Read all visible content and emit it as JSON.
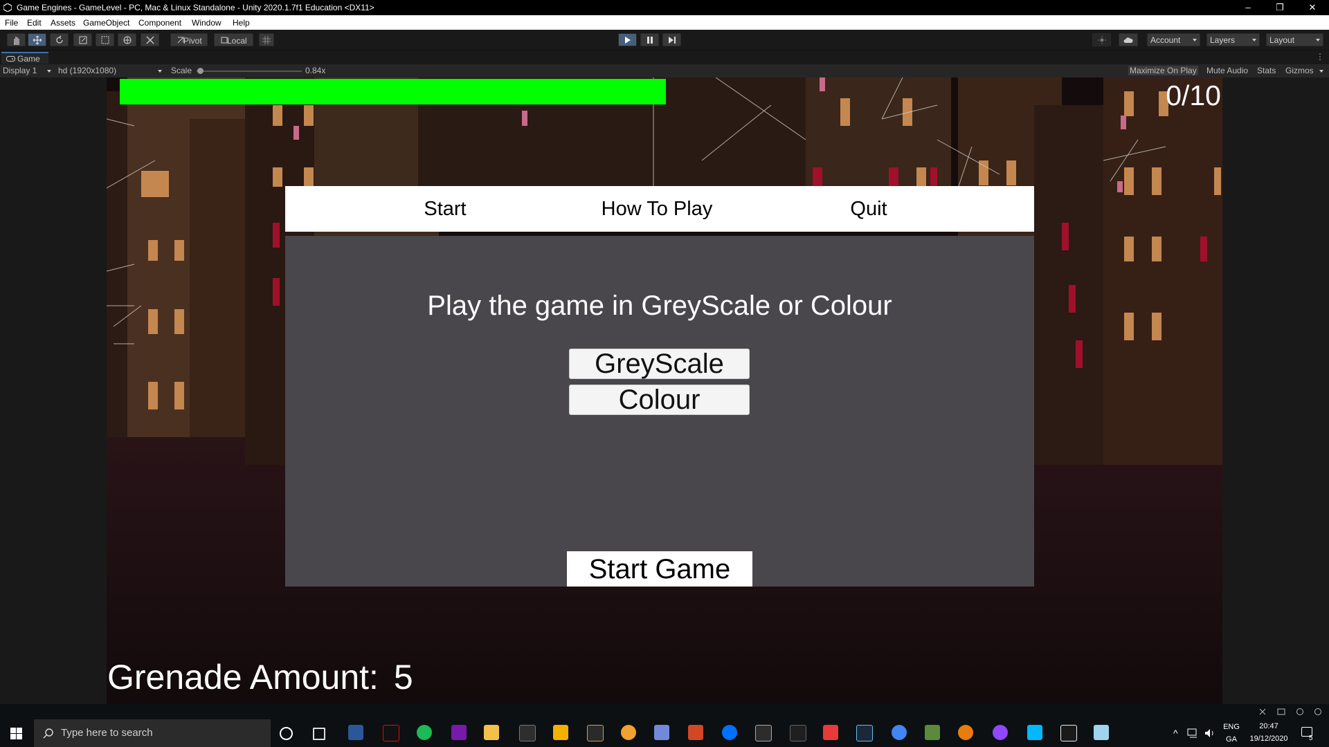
{
  "window": {
    "title": "Game Engines - GameLevel - PC, Mac & Linux Standalone - Unity 2020.1.7f1 Education <DX11>",
    "minimize": "–",
    "restore": "❐",
    "close": "✕"
  },
  "menubar": [
    "File",
    "Edit",
    "Assets",
    "GameObject",
    "Component",
    "Window",
    "Help"
  ],
  "toolbar": {
    "pivot_label": "Pivot",
    "local_label": "Local",
    "account_label": "Account",
    "layers_label": "Layers",
    "layout_label": "Layout"
  },
  "game_tab": {
    "label": "Game",
    "display": "Display 1",
    "resolution": "hd (1920x1080)",
    "scale_label": "Scale",
    "scale_value": "0.84x",
    "maximize": "Maximize On Play",
    "mute": "Mute Audio",
    "stats": "Stats",
    "gizmos": "Gizmos"
  },
  "hud": {
    "health_fraction": 1.0,
    "health_color": "#00ff00",
    "counter": "0/10",
    "grenade_label": "Grenade Amount:",
    "grenade_value": "5"
  },
  "menu": {
    "tabs": [
      "Start",
      "How To Play",
      "Quit"
    ],
    "prompt": "Play the game in GreyScale or Colour",
    "options": [
      "GreyScale",
      "Colour"
    ],
    "start_button": "Start Game"
  },
  "taskbar": {
    "search_placeholder": "Type here to search",
    "lang_top": "ENG",
    "lang_bottom": "GA",
    "time": "20:47",
    "date": "19/12/2020",
    "notifications": "5"
  },
  "colors": {
    "editor_bg": "#191919",
    "panel_grey": "#49474b",
    "health_green": "#00ff00"
  }
}
